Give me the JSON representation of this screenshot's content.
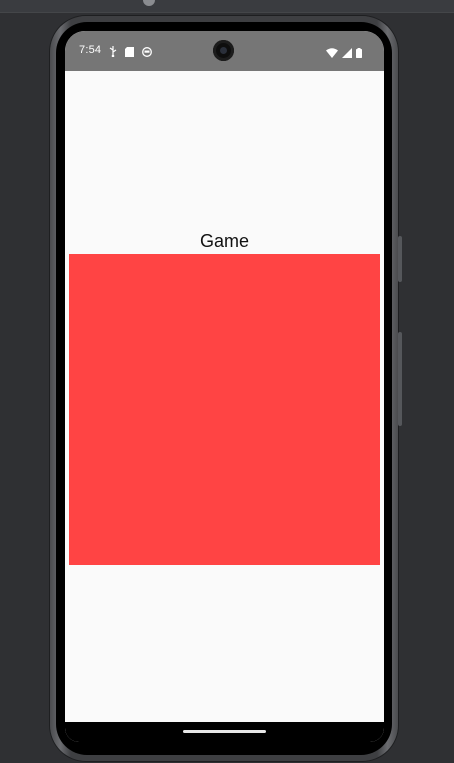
{
  "status_bar": {
    "time": "7:54",
    "left_icons": [
      "usb-debug-icon",
      "sd-card-icon",
      "app-notification-icon"
    ],
    "right_icons": [
      "wifi-icon",
      "signal-icon",
      "battery-icon"
    ]
  },
  "app": {
    "title": "Game",
    "board_color": "#ff4444",
    "background_color": "#fafafa"
  }
}
